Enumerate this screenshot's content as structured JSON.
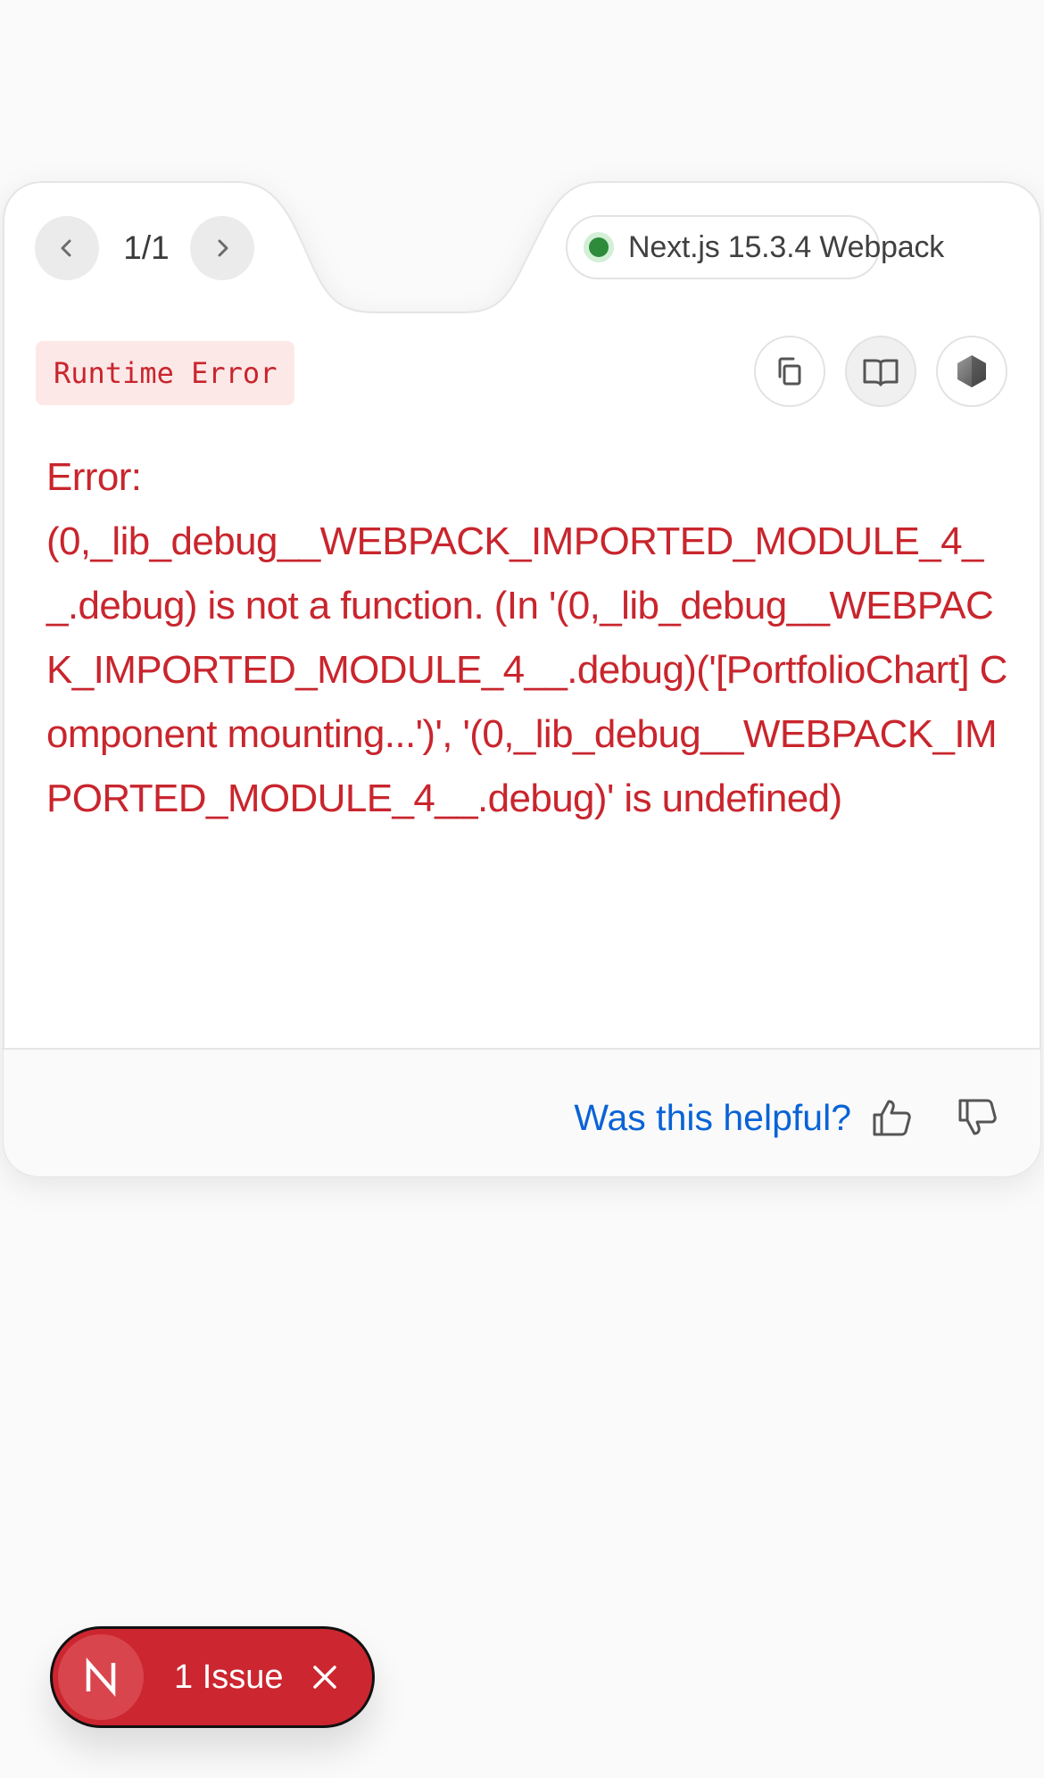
{
  "header": {
    "prev_icon": "chevron-left-icon",
    "next_icon": "chevron-right-icon",
    "page_count": "1/1",
    "version": "Next.js 15.3.4 Webpack",
    "status_color": "#2e8b3c"
  },
  "error": {
    "type": "Runtime Error",
    "message": "Error:\n(0,_lib_debug__WEBPACK_IMPORTED_MODULE_4__.debug) is not a function. (In '(0,_lib_debug__WEBPACK_IMPORTED_MODULE_4__.debug)('[PortfolioChart] Component mounting...')', '(0,_lib_debug__WEBPACK_IMPORTED_MODULE_4__.debug)' is undefined)",
    "color": "#c9252d"
  },
  "actions": {
    "copy_icon": "copy-icon",
    "docs_icon": "book-icon",
    "node_icon": "nodejs-icon"
  },
  "footer": {
    "helpful": "Was this helpful?",
    "link_color": "#0a63d6"
  },
  "issues": {
    "logo": "N",
    "label": "1 Issue",
    "close_icon": "close-icon",
    "background": "#cc2630"
  }
}
